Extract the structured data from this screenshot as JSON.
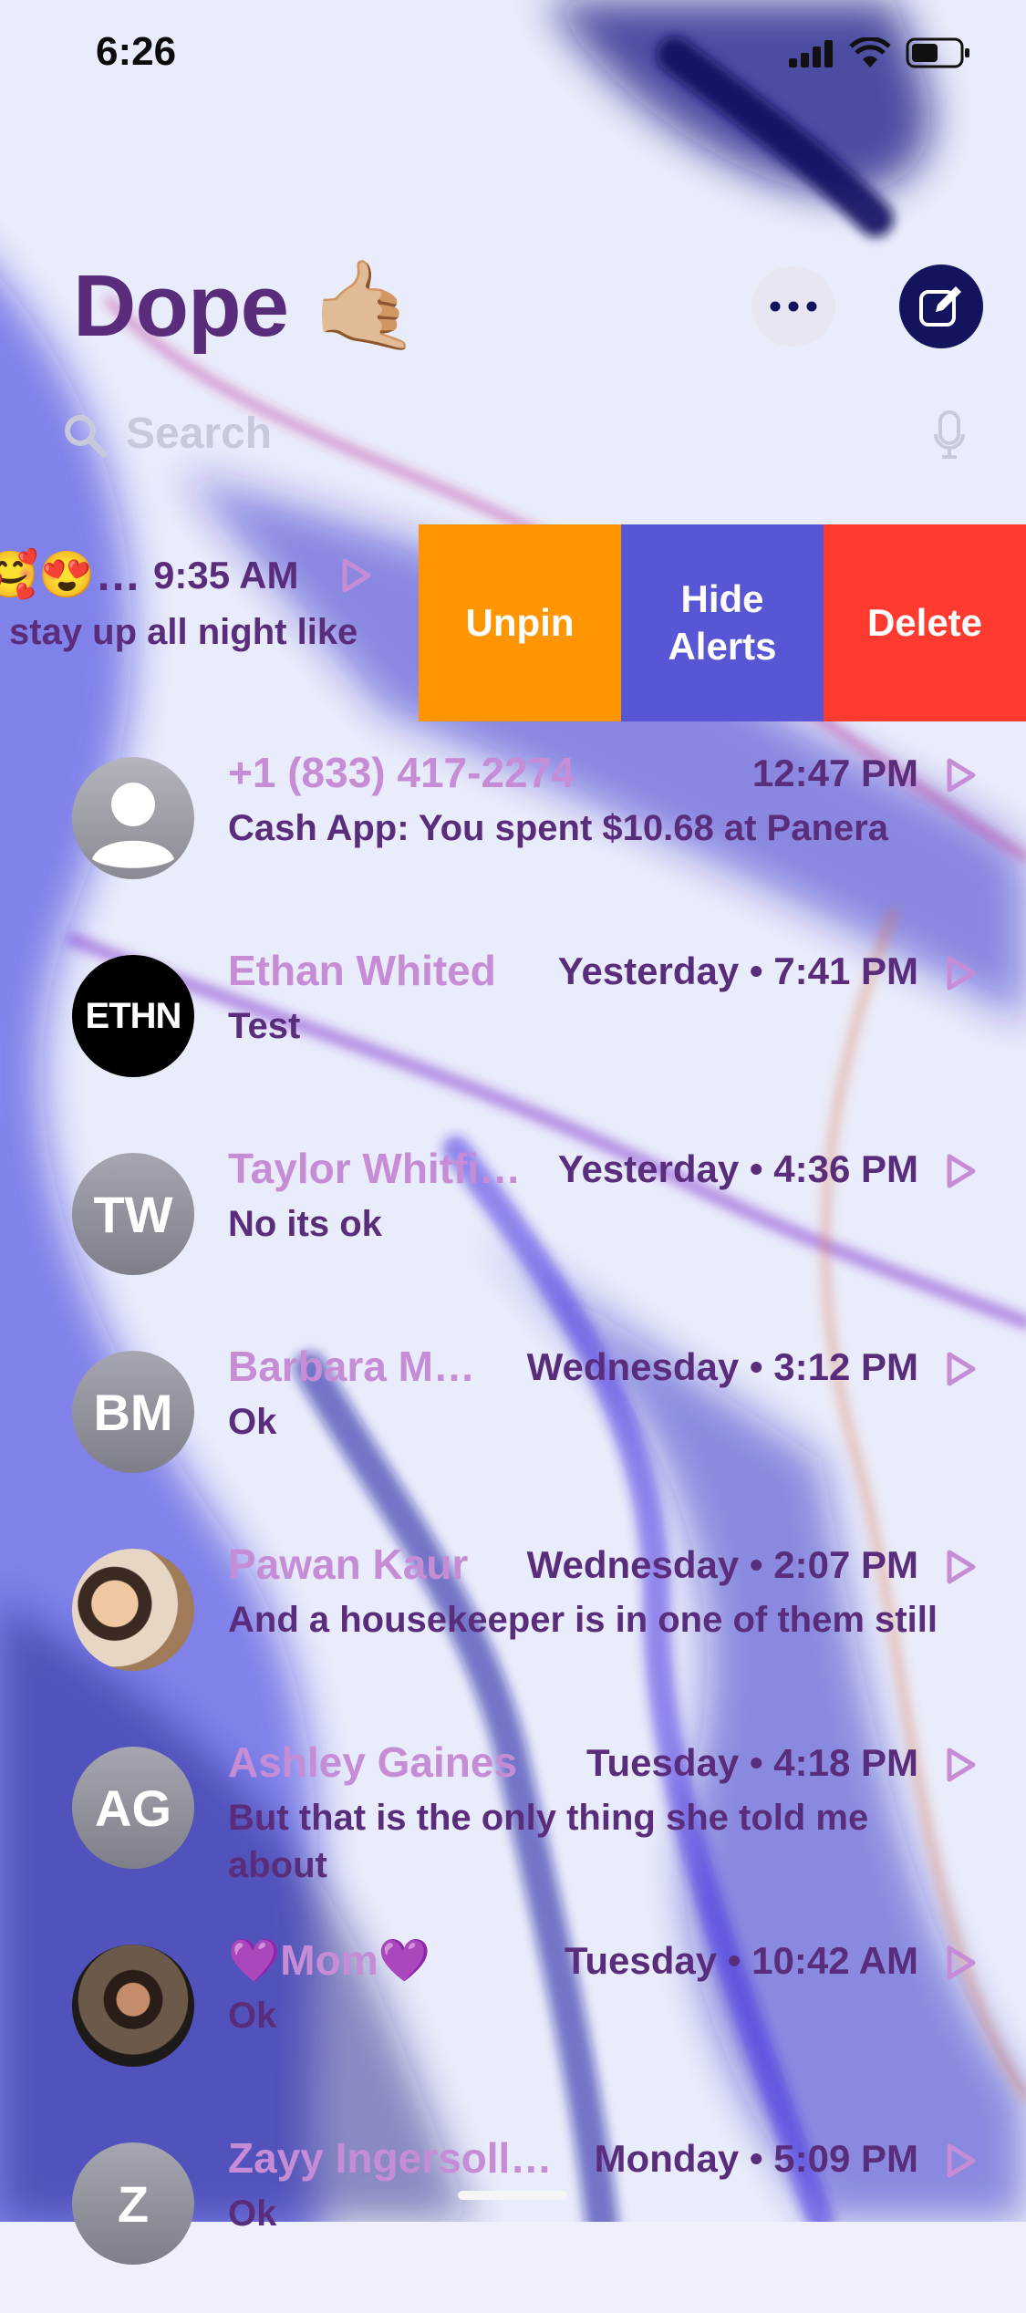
{
  "status": {
    "time": "6:26"
  },
  "header": {
    "title": "Dope 🤙🏼"
  },
  "search": {
    "placeholder": "Search"
  },
  "pinned": {
    "emoji": "🥰😍…",
    "time": "9:35 AM",
    "preview": "stay up all night like",
    "actions": {
      "unpin": "Unpin",
      "hide_alerts": "Hide\nAlerts",
      "delete": "Delete"
    }
  },
  "conversations": [
    {
      "name": "+1 (833) 417-2274",
      "time": "12:47 PM",
      "preview": "Cash App: You spent $10.68 at Panera",
      "avatar": "person-icon"
    },
    {
      "name": "Ethan Whited",
      "time": "Yesterday • 7:41 PM",
      "preview": "Test",
      "avatar": "ETHN"
    },
    {
      "name": "Taylor Whitfi…",
      "time": "Yesterday • 4:36 PM",
      "preview": "No its ok",
      "initials": "TW"
    },
    {
      "name": "Barbara M…",
      "time": "Wednesday • 3:12 PM",
      "preview": "Ok",
      "initials": "BM"
    },
    {
      "name": "Pawan Kaur",
      "time": "Wednesday • 2:07 PM",
      "preview": "And a housekeeper is in one of them still",
      "avatar": "photo"
    },
    {
      "name": "Ashley Gaines",
      "time": "Tuesday • 4:18 PM",
      "preview": "But that is the only thing she told me about",
      "initials": "AG"
    },
    {
      "name": "💜Mom💜",
      "time": "Tuesday • 10:42 AM",
      "preview": "Ok",
      "avatar": "photo"
    },
    {
      "name": "Zayy Ingersoll…",
      "time": "Monday • 5:09 PM",
      "preview": "Ok",
      "initials": "Z"
    }
  ],
  "colors": {
    "accent": "#5a2d7c",
    "name": "#c68dd6",
    "unpin": "#ff9500",
    "hide": "#5956d6",
    "delete": "#ff3b30"
  }
}
